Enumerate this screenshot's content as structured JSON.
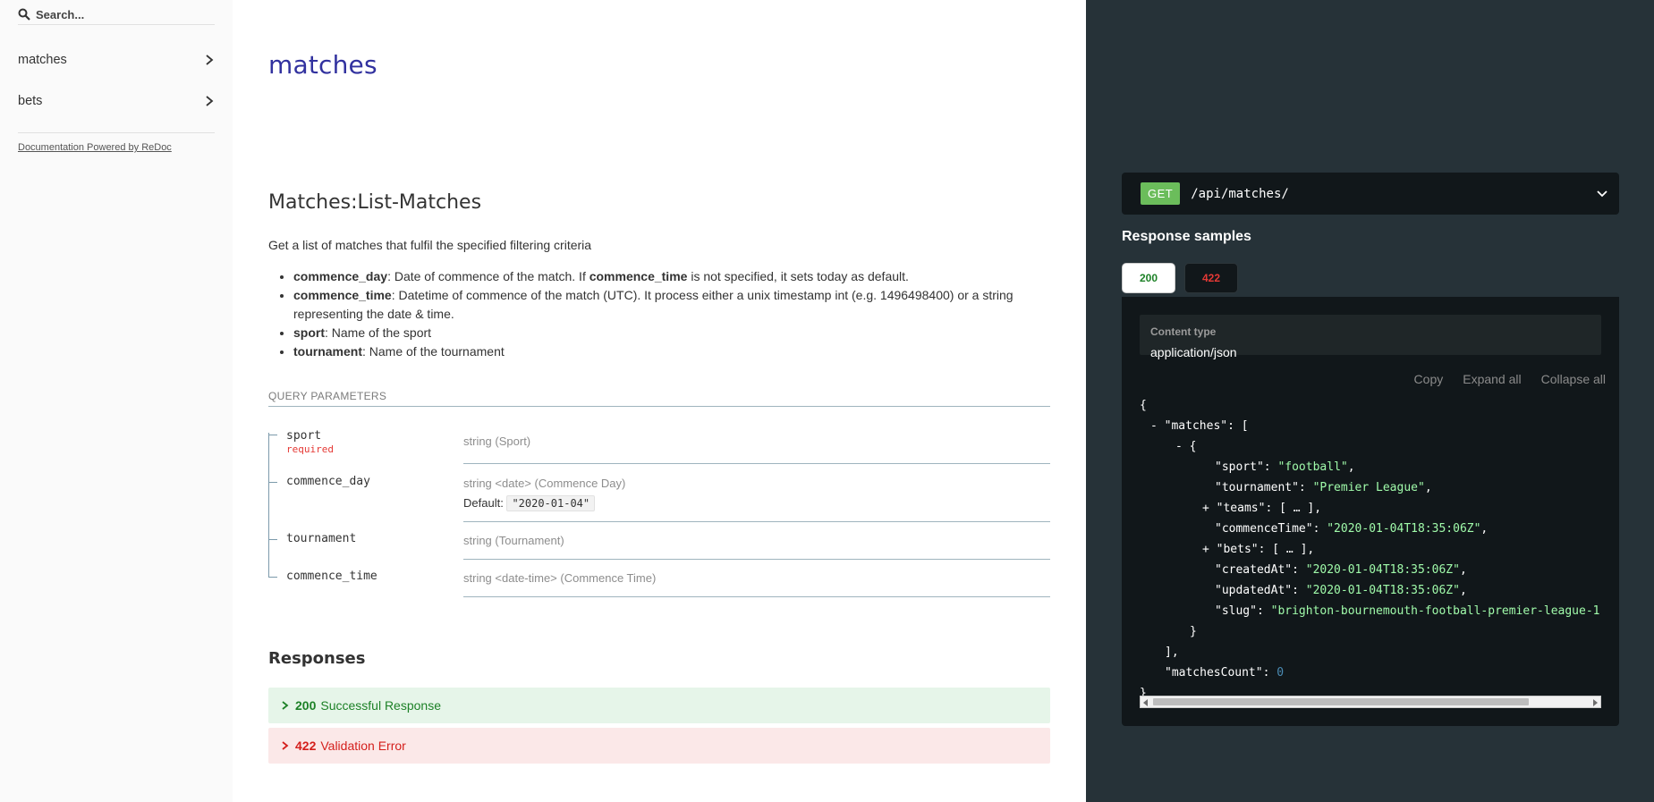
{
  "sidebar": {
    "search_placeholder": "Search...",
    "items": [
      {
        "label": "matches"
      },
      {
        "label": "bets"
      }
    ],
    "powered_by": "Documentation Powered by ReDoc"
  },
  "main": {
    "tag_title": "matches",
    "operation_title": "Matches:List-Matches",
    "description": "Get a list of matches that fulfil the specified filtering criteria",
    "bullets": [
      {
        "name": "commence_day",
        "text_before": ": Date of commence of the match. If ",
        "bold_inline": "commence_time",
        "text_after": " is not specified, it sets today as default."
      },
      {
        "name": "commence_time",
        "text": ": Datetime of commence of the match (UTC). It process either a unix timestamp int (e.g. 1496498400) or a string representing the date & time."
      },
      {
        "name": "sport",
        "text": ": Name of the sport"
      },
      {
        "name": "tournament",
        "text": ": Name of the tournament"
      }
    ],
    "params_header": "QUERY PARAMETERS",
    "params": [
      {
        "name": "sport",
        "required": "required",
        "type": "string (Sport)"
      },
      {
        "name": "commence_day",
        "type": "string <date> (Commence Day)",
        "default_label": "Default:",
        "default_value": "\"2020-01-04\""
      },
      {
        "name": "tournament",
        "type": "string (Tournament)"
      },
      {
        "name": "commence_time",
        "type": "string <date-time> (Commence Time)"
      }
    ],
    "responses_title": "Responses",
    "responses": [
      {
        "code": "200",
        "label": "Successful Response",
        "color": "#1d8127"
      },
      {
        "code": "422",
        "label": "Validation Error",
        "color": "#d41f1c"
      }
    ]
  },
  "right": {
    "method": "GET",
    "path": "/api/matches/",
    "samples_title": "Response samples",
    "tabs": [
      "200",
      "422"
    ],
    "content_type_label": "Content type",
    "content_type_value": "application/json",
    "actions": [
      "Copy",
      "Expand all",
      "Collapse all"
    ],
    "json": {
      "open_brace": "{",
      "toggle_minus": "-",
      "toggle_plus": "+",
      "matches_key": "\"matches\"",
      "open_bracket": "[",
      "sport_key": "\"sport\"",
      "sport_val": "\"football\"",
      "tournament_key": "\"tournament\"",
      "tournament_val": "\"Premier League\"",
      "teams_key": "\"teams\"",
      "collapsed": "[ … ]",
      "commence_key": "\"commenceTime\"",
      "commence_val": "\"2020-01-04T18:35:06Z\"",
      "bets_key": "\"bets\"",
      "created_key": "\"createdAt\"",
      "created_val": "\"2020-01-04T18:35:06Z\"",
      "updated_key": "\"updatedAt\"",
      "updated_val": "\"2020-01-04T18:35:06Z\"",
      "slug_key": "\"slug\"",
      "slug_val": "\"brighton-bournemouth-football-premier-league-1",
      "close_obj": "}",
      "close_arr": "],",
      "count_key": "\"matchesCount\"",
      "count_val": "0",
      "close_brace": "}"
    }
  },
  "colors": {
    "accent": "#32329f",
    "get_badge": "#6bbd5b",
    "right_panel": "#263238",
    "json_string": "#a0fbaa"
  }
}
